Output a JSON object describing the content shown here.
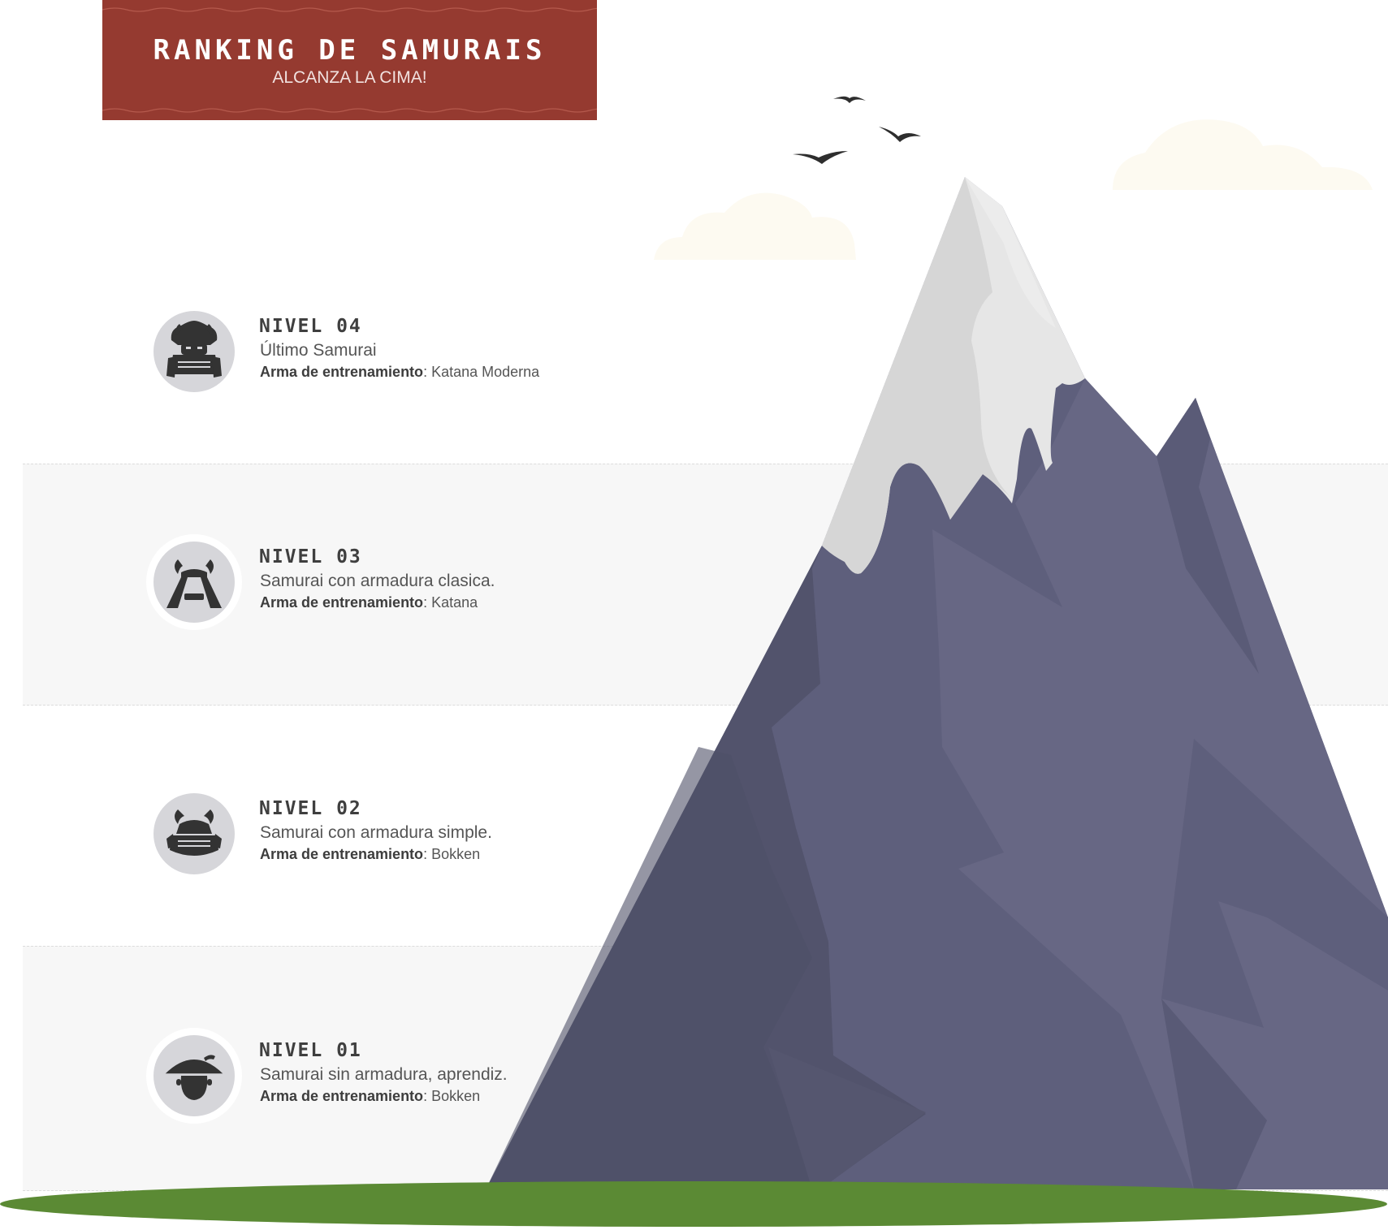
{
  "header": {
    "title": "RANKING DE SAMURAIS",
    "subtitle": "ALCANZA LA CIMA!"
  },
  "levels": [
    {
      "title": "NIVEL 04",
      "description": "Último Samurai",
      "weapon_label": "Arma de entrenamiento",
      "weapon": ": Katana Moderna",
      "icon": "samurai-full-armor-icon"
    },
    {
      "title": "NIVEL 03",
      "description": "Samurai con armadura clasica.",
      "weapon_label": "Arma de entrenamiento",
      "weapon": ": Katana",
      "icon": "samurai-helmet-icon"
    },
    {
      "title": "NIVEL 02",
      "description": "Samurai con armadura simple.",
      "weapon_label": "Arma de entrenamiento",
      "weapon": ": Bokken",
      "icon": "samurai-simple-armor-icon"
    },
    {
      "title": "NIVEL 01",
      "description": "Samurai sin armadura, aprendiz.",
      "weapon_label": "Arma de entrenamiento",
      "weapon": ": Bokken",
      "icon": "apprentice-hat-icon"
    }
  ],
  "colors": {
    "banner": "#953a30",
    "mountain_dark": "#52536c",
    "mountain_mid": "#5e5f7c",
    "mountain_light": "#676784",
    "snow": "#e6e6e6",
    "grass": "#5b8a34",
    "cloud": "#fdfaf1"
  }
}
